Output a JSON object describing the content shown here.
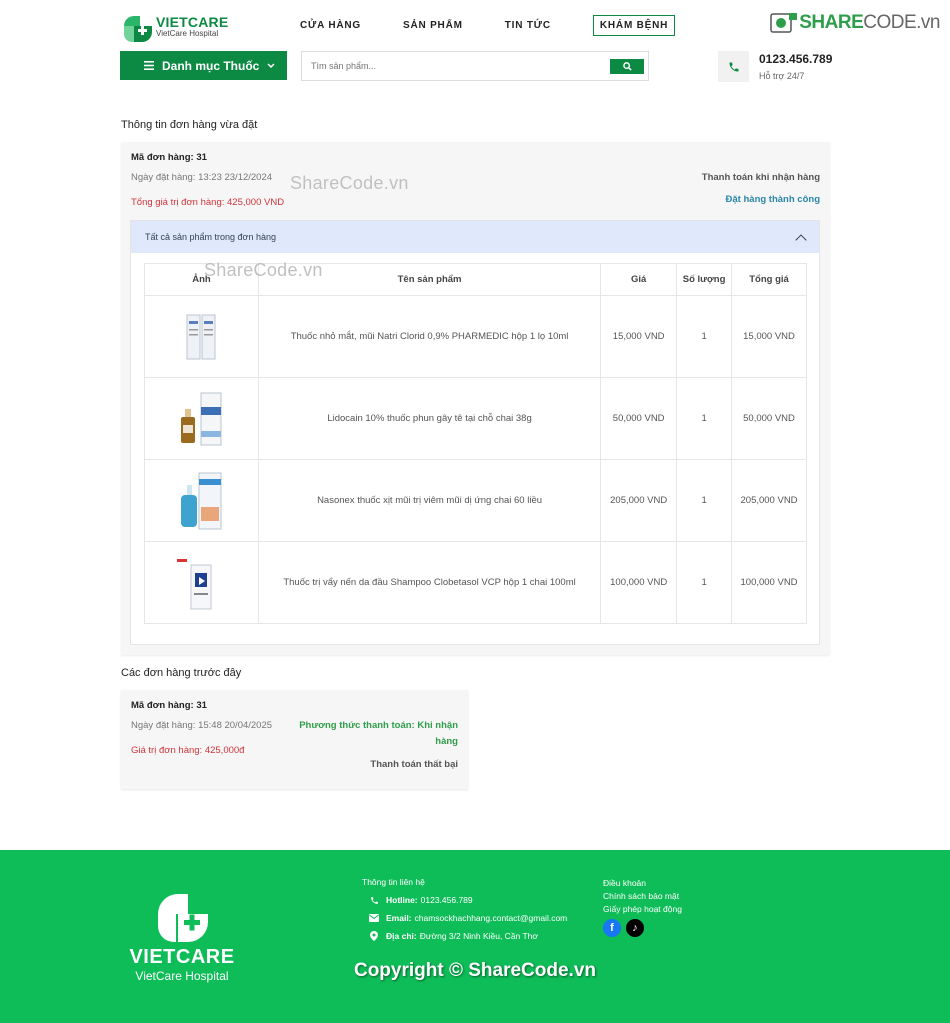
{
  "header": {
    "brand": "VIETCARE",
    "brand_sub": "VietCare Hospital",
    "nav": [
      "CỬA HÀNG",
      "SẢN PHẨM",
      "TIN TỨC"
    ],
    "nav_button": "KHÁM BỆNH",
    "category_label": "Danh mục Thuốc",
    "search_placeholder": "Tìm sản phẩm...",
    "phone": "0123.456.789",
    "support_hint": "Hỗ trợ 24/7",
    "watermark_brand": "SHARE",
    "watermark_rest": "CODE.vn"
  },
  "recent": {
    "section_title": "Thông tin đơn hàng vừa đặt",
    "order_code": "Mã đơn hàng: 31",
    "order_date": "Ngày đặt hàng: 13:23 23/12/2024",
    "order_total": "Tổng giá trị đơn hàng: 425,000 VND",
    "payment": "Thanh toán khi nhận hàng",
    "status": "Đặt hàng thành công",
    "accordion_title": "Tất cả sản phẩm trong đơn hàng",
    "columns": [
      "Ảnh",
      "Tên sản phẩm",
      "Giá",
      "Số lượng",
      "Tổng giá"
    ],
    "items": [
      {
        "name": "Thuốc nhỏ mắt, mũi Natri Clorid 0,9% PHARMEDIC hộp 1 lọ 10ml",
        "price": "15,000 VND",
        "qty": "1",
        "total": "15,000 VND"
      },
      {
        "name": "Lidocain 10% thuốc phun gây tê tại chỗ chai 38g",
        "price": "50,000 VND",
        "qty": "1",
        "total": "50,000 VND"
      },
      {
        "name": "Nasonex thuốc xịt mũi trị viêm mũi dị ứng chai 60 liều",
        "price": "205,000 VND",
        "qty": "1",
        "total": "205,000 VND"
      },
      {
        "name": "Thuốc trị vẩy nến da đầu Shampoo Clobetasol VCP hộp 1 chai 100ml",
        "price": "100,000 VND",
        "qty": "1",
        "total": "100,000 VND"
      }
    ]
  },
  "previous": {
    "section_title": "Các đơn hàng trước đây",
    "order_code": "Mã đơn hàng: 31",
    "order_date": "Ngày đặt hàng: 15:48 20/04/2025",
    "order_total": "Giá trị đơn hàng: 425,000đ",
    "method": "Phương thức thanh toán: Khi nhận hàng",
    "status": "Thanh toán thất bại"
  },
  "footer": {
    "brand": "VIETCARE",
    "brand_sub": "VietCare Hospital",
    "contact_title": "Thông tin liên hệ",
    "hotline_label": "Hotline:",
    "hotline": "0123.456.789",
    "email_label": "Email:",
    "email": "chamsockhachhang.contact@gmail.com",
    "address_label": "Địa chỉ:",
    "address": "Đường 3/2 Ninh Kiều, Cần Thơ",
    "links": [
      "Điều khoản",
      "Chính sách bảo mật",
      "Giấy phép hoạt động"
    ],
    "copyright": "Copyright © ShareCode.vn"
  },
  "watermark": "ShareCode.vn",
  "colors": {
    "primary": "#0c8a43",
    "footer": "#0fbd58",
    "price_red": "#d0343b",
    "status_blue": "#2a86a8"
  }
}
